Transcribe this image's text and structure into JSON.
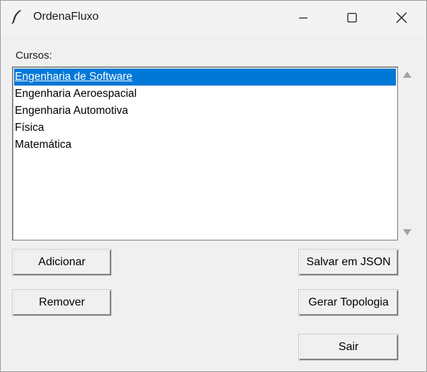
{
  "window": {
    "title": "OrdenaFluxo",
    "icon": "feather-icon",
    "controls": [
      "minimize-icon",
      "maximize-icon",
      "close-icon"
    ]
  },
  "courses": {
    "label": "Cursos:",
    "items": [
      "Engenharia de Software",
      "Engenharia Aeroespacial",
      "Engenharia Automotiva",
      "Física",
      "Matemática"
    ],
    "selected_index": 0
  },
  "buttons": {
    "add": "Adicionar",
    "remove": "Remover",
    "save_json": "Salvar em JSON",
    "topology": "Gerar Topologia",
    "exit": "Sair"
  },
  "colors": {
    "selection": "#0078d7",
    "window_bg": "#f0f0f0"
  }
}
